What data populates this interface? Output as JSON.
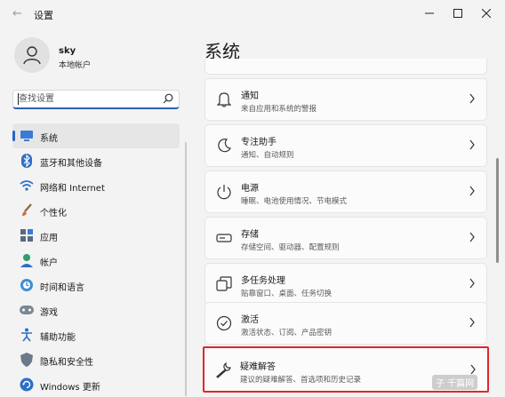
{
  "window": {
    "title": "设置",
    "back_icon": "back-arrow-icon"
  },
  "user": {
    "name": "sky",
    "account_type": "本地帐户"
  },
  "search": {
    "placeholder": "查找设置"
  },
  "nav": {
    "items": [
      {
        "label": "系统",
        "icon": "system-monitor-icon",
        "selected": true
      },
      {
        "label": "蓝牙和其他设备",
        "icon": "bluetooth-icon"
      },
      {
        "label": "网络和 Internet",
        "icon": "wifi-icon"
      },
      {
        "label": "个性化",
        "icon": "paint-brush-icon"
      },
      {
        "label": "应用",
        "icon": "apps-icon"
      },
      {
        "label": "帐户",
        "icon": "account-icon"
      },
      {
        "label": "时间和语言",
        "icon": "globe-clock-icon"
      },
      {
        "label": "游戏",
        "icon": "game-controller-icon"
      },
      {
        "label": "辅助功能",
        "icon": "accessibility-icon"
      },
      {
        "label": "隐私和安全性",
        "icon": "shield-icon"
      },
      {
        "label": "Windows 更新",
        "icon": "windows-update-icon"
      }
    ]
  },
  "main": {
    "title": "系统",
    "cards": [
      {
        "title": "通知",
        "subtitle": "来自应用和系统的警报",
        "icon": "bell-icon"
      },
      {
        "title": "专注助手",
        "subtitle": "通知、自动规则",
        "icon": "moon-icon"
      },
      {
        "title": "电源",
        "subtitle": "睡眠、电池使用情况、节电模式",
        "icon": "power-icon"
      },
      {
        "title": "存储",
        "subtitle": "存储空间、驱动器、配置规则",
        "icon": "storage-drive-icon"
      },
      {
        "title": "多任务处理",
        "subtitle": "贴靠窗口、桌面、任务切换",
        "icon": "multitask-icon"
      },
      {
        "title": "激活",
        "subtitle": "激活状态、订阅、产品密钥",
        "icon": "check-circle-icon"
      },
      {
        "title": "疑难解答",
        "subtitle": "建议的疑难解答、首选项和历史记录",
        "icon": "wrench-icon",
        "highlighted": true
      }
    ]
  },
  "watermark": {
    "text": "子 千篇网"
  },
  "colors": {
    "accent": "#2767c4",
    "highlight": "#e0262c",
    "background": "#f3f3f3"
  }
}
